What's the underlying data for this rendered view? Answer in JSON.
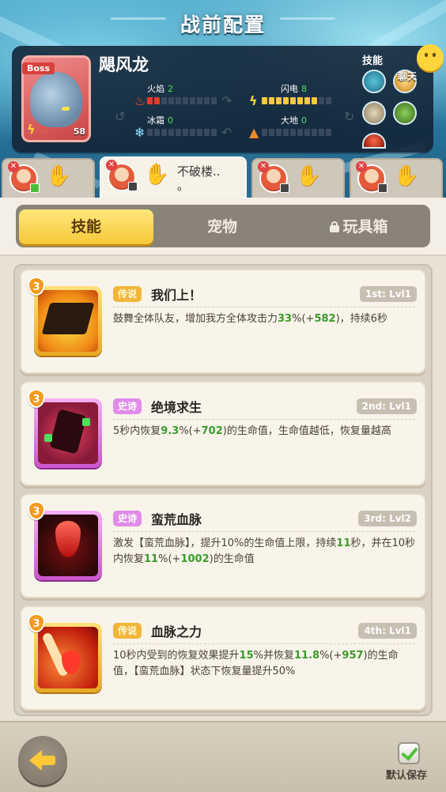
{
  "header": {
    "title": "战前配置"
  },
  "boss": {
    "tag": "Boss",
    "name": "飓风龙",
    "level": "58",
    "elements": [
      {
        "label": "火焰",
        "value": "2",
        "filled": 2
      },
      {
        "label": "闪电",
        "value": "8",
        "filled": 8
      },
      {
        "label": "冰霜",
        "value": "0",
        "filled": 0
      },
      {
        "label": "大地",
        "value": "0",
        "filled": 0
      }
    ],
    "skills_label": "技能"
  },
  "chat": {
    "label": "聊天"
  },
  "hero_tabs": [
    {
      "name": "",
      "badge": "green"
    },
    {
      "name": "不破楼..",
      "badge": "gray",
      "active": true,
      "extra": "。"
    },
    {
      "name": "",
      "badge": "gray"
    },
    {
      "name": "",
      "badge": "gray"
    }
  ],
  "section_tabs": [
    {
      "label": "技能",
      "active": true
    },
    {
      "label": "宠物"
    },
    {
      "label": "玩具箱",
      "locked": true
    }
  ],
  "skills": [
    {
      "level": "3",
      "rarity": "传说",
      "rarity_class": "legend",
      "name": "我们上！",
      "slot": "1st: Lvl1",
      "desc_parts": [
        {
          "t": "鼓舞全体队友，增加我方全体攻击力"
        },
        {
          "t": "33",
          "hl": true
        },
        {
          "t": "%(+"
        },
        {
          "t": "582",
          "hl": true
        },
        {
          "t": ")，持续6秒"
        }
      ]
    },
    {
      "level": "3",
      "rarity": "史诗",
      "rarity_class": "epic",
      "name": "绝境求生",
      "slot": "2nd: Lvl1",
      "desc_parts": [
        {
          "t": "5秒内恢复"
        },
        {
          "t": "9.3",
          "hl": true
        },
        {
          "t": "%(+"
        },
        {
          "t": "702",
          "hl": true
        },
        {
          "t": ")的生命值，生命值越低，恢复量越高"
        }
      ]
    },
    {
      "level": "3",
      "rarity": "史诗",
      "rarity_class": "epic",
      "name": "蛮荒血脉",
      "slot": "3rd: Lvl2",
      "desc_parts": [
        {
          "t": "激发【蛮荒血脉】，提升10%的生命值上限，持续"
        },
        {
          "t": "11",
          "hl": true
        },
        {
          "t": "秒，并在10秒内恢复"
        },
        {
          "t": "11",
          "hl": true
        },
        {
          "t": "%(+"
        },
        {
          "t": "1002",
          "hl": true
        },
        {
          "t": ")的生命值"
        }
      ]
    },
    {
      "level": "3",
      "rarity": "传说",
      "rarity_class": "legend",
      "name": "血脉之力",
      "slot": "4th: Lvl1",
      "desc_parts": [
        {
          "t": "10秒内受到的恢复效果提升"
        },
        {
          "t": "15",
          "hl": true
        },
        {
          "t": "%并恢复"
        },
        {
          "t": "11.8",
          "hl": true
        },
        {
          "t": "%(+"
        },
        {
          "t": "957",
          "hl": true
        },
        {
          "t": ")的生命值，【蛮荒血脉】状态下恢复量提升50%"
        }
      ]
    }
  ],
  "footer": {
    "save_label": "默认保存"
  },
  "colors": {
    "accent_gold": "#f7c83a",
    "highlight_green": "#3a9a2a",
    "epic_purple": "#e08ce8",
    "legend_gold": "#f2b63a"
  }
}
